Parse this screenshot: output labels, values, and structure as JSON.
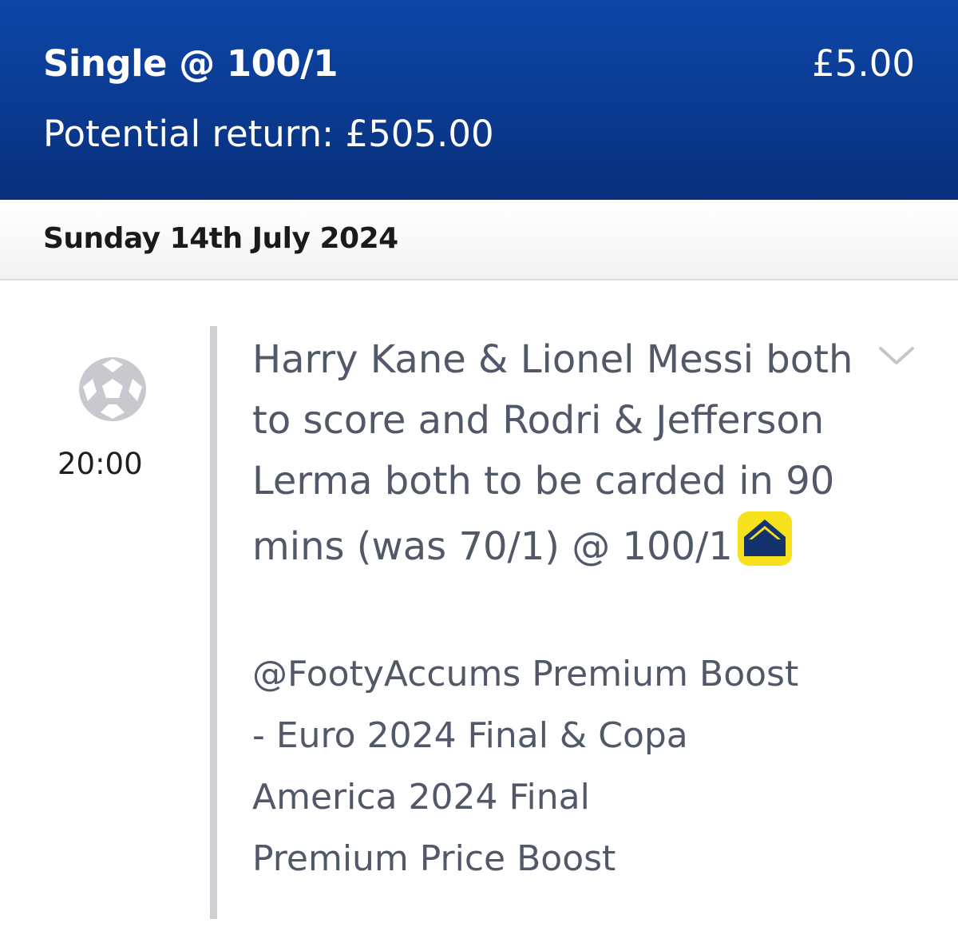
{
  "header": {
    "bet_type": "Single @ 100/1",
    "stake": "£5.00",
    "potential_return": "Potential return: £505.00"
  },
  "date_bar": {
    "date": "Sunday 14th July 2024"
  },
  "selection": {
    "sport_icon": "football-icon",
    "kickoff": "20:00",
    "description": "Harry Kane & Lionel Messi both to score and Rodri & Jefferson Lerma both to be carded in 90 mins (was 70/1) @ 100/1",
    "boost_icon": "price-boost-icon",
    "market_line1": "@FootyAccums Premium Boost",
    "market_line2": "- Euro 2024 Final & Copa",
    "market_line3": "America 2024 Final",
    "market_line4": "Premium Price Boost",
    "expand_icon": "chevron-down-icon"
  },
  "colors": {
    "header_bg": "#0a3a90",
    "boost_badge": "#f7e11c",
    "boost_arrow": "#14336e",
    "text_muted": "#515868"
  }
}
